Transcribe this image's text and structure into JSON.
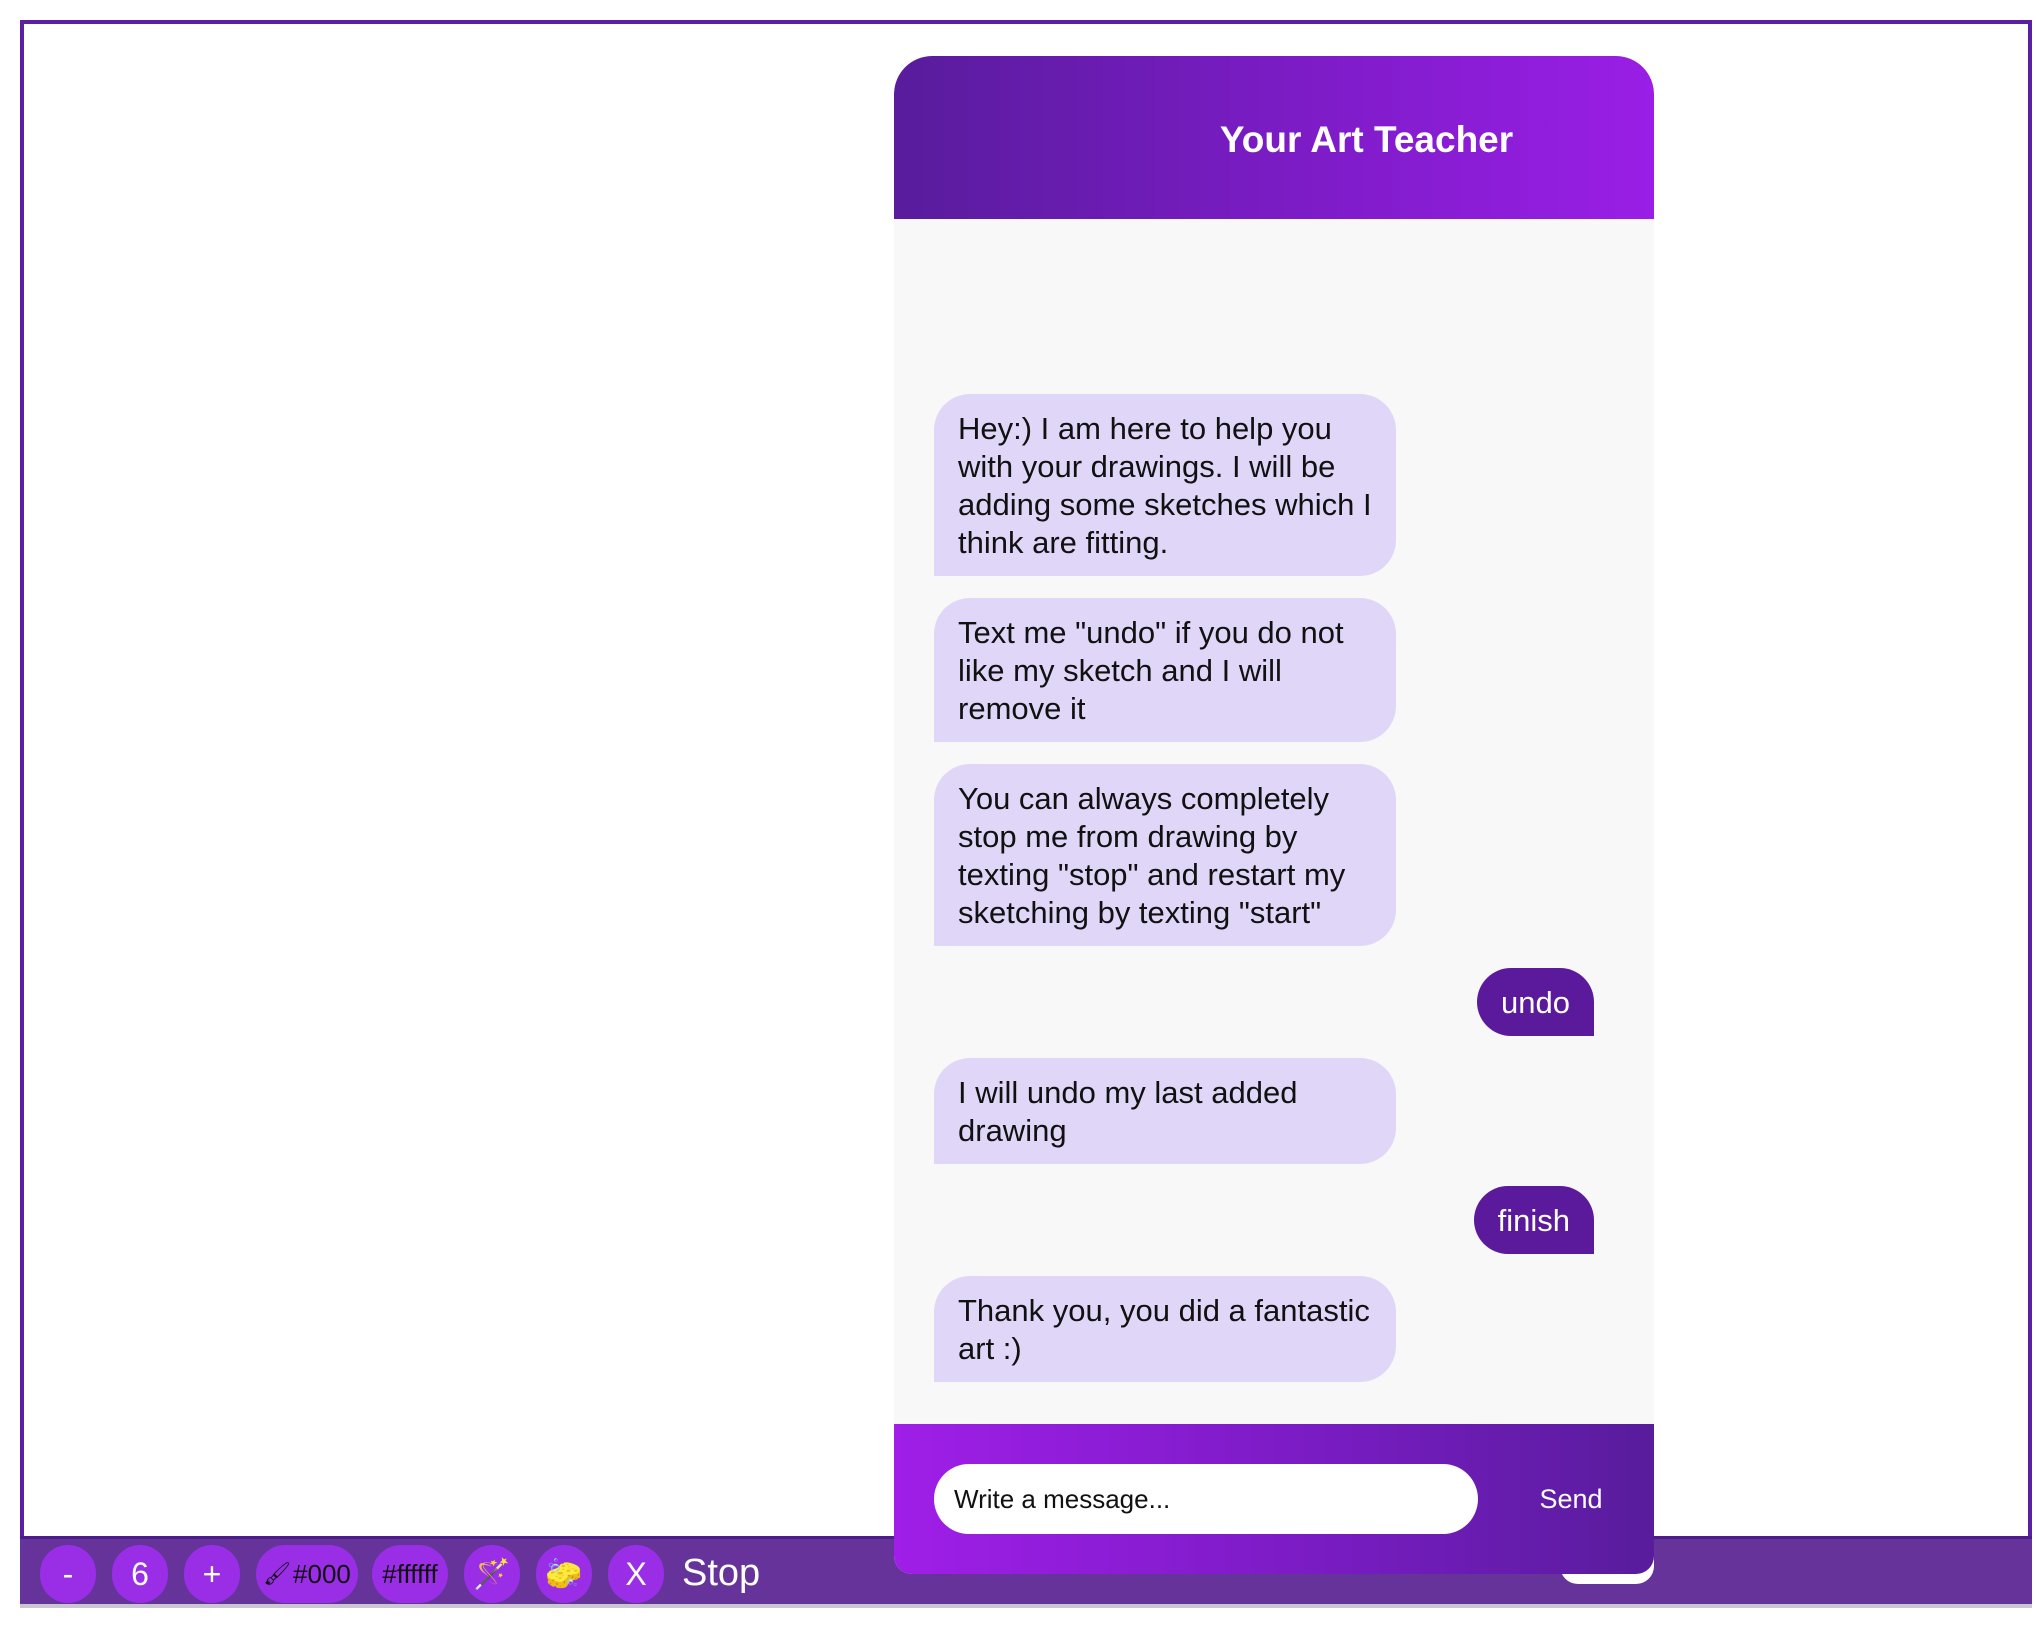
{
  "chat": {
    "title": "Your Art Teacher",
    "messages": [
      {
        "from": "bot",
        "text": "Hey:) I am here to help you with your drawings. I will be adding some sketches which I think are fitting."
      },
      {
        "from": "bot",
        "text": "Text me \"undo\" if you do not like my sketch and I will remove it"
      },
      {
        "from": "bot",
        "text": "You can always completely stop me from drawing by texting \"stop\" and restart my sketching by texting \"start\""
      },
      {
        "from": "user",
        "text": "undo"
      },
      {
        "from": "bot",
        "text": "I will undo my last added drawing"
      },
      {
        "from": "user",
        "text": "finish"
      },
      {
        "from": "bot",
        "text": "Thank you, you did a fantastic art :)"
      }
    ],
    "input": {
      "placeholder": "Write a message..."
    },
    "send_label": "Send"
  },
  "toolbar": {
    "decrease_label": "-",
    "size_value": "6",
    "increase_label": "+",
    "stroke_color_label": "#000",
    "fill_color_label": "#ffffff",
    "clear_label": "X",
    "stop_label": "Stop",
    "icons": {
      "brush": "brush-icon",
      "magic_wand": "magic-wand-icon",
      "eraser": "sponge-eraser-icon"
    }
  },
  "colors": {
    "accent_purple": "#9a2ee6",
    "dark_purple": "#5b1a9c",
    "bot_bubble": "#e0d6f8",
    "toolbar_bg": "#66339a"
  }
}
